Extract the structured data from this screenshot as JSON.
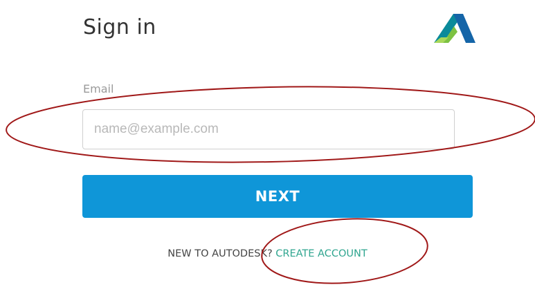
{
  "header": {
    "title": "Sign in"
  },
  "form": {
    "email_label": "Email",
    "email_placeholder": "name@example.com",
    "email_value": "",
    "next_label": "NEXT"
  },
  "footer": {
    "prompt": "NEW TO AUTODESK?",
    "create_account_label": "CREATE ACCOUNT"
  },
  "icons": {
    "logo": "autodesk-logo-icon"
  },
  "colors": {
    "primary_button": "#0f96d8",
    "link": "#2fa58f",
    "annotation": "#a01818",
    "logo_dark": "#0a7d8c",
    "logo_light": "#7dc242"
  }
}
